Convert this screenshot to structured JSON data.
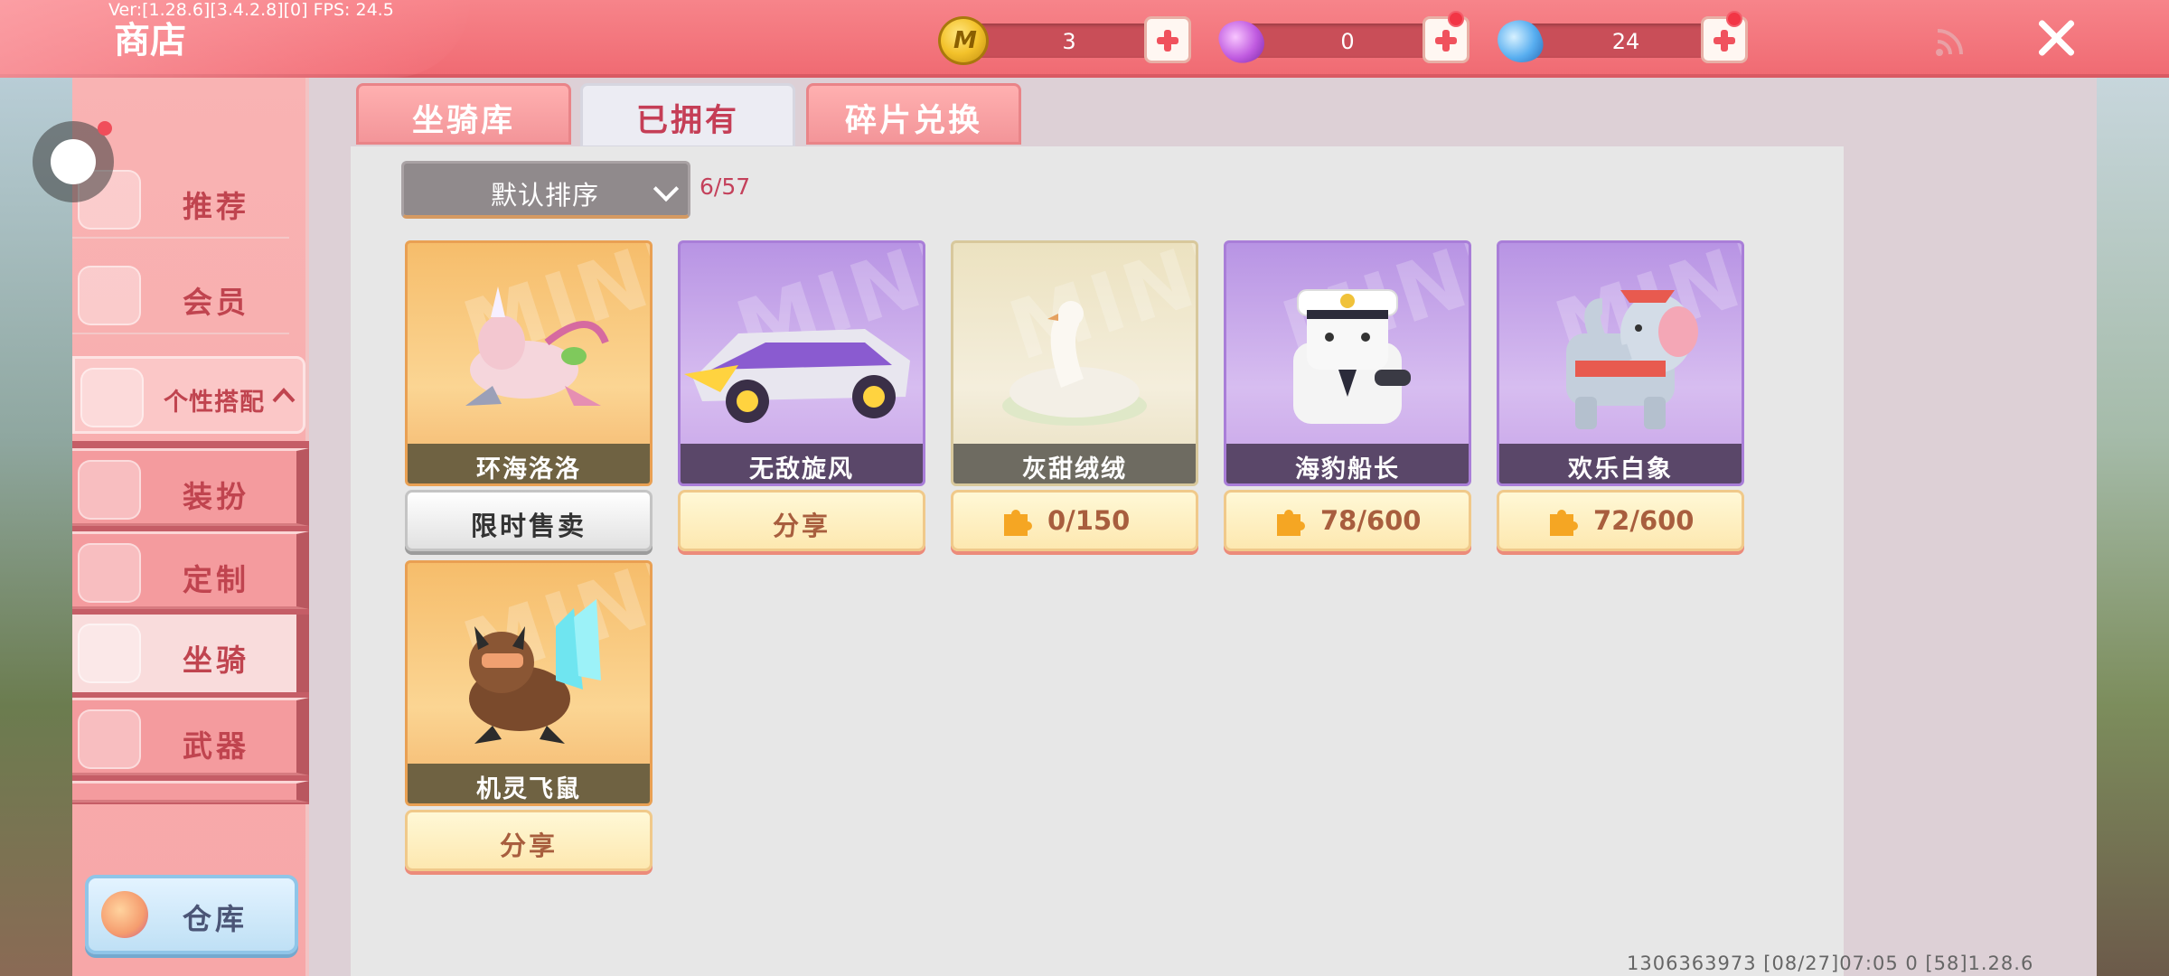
{
  "header": {
    "version_text": "Ver:[1.28.6][3.4.2.8][0] FPS: 24.5",
    "title": "商店",
    "currencies": [
      {
        "icon": "mini-coin-icon",
        "value": "3"
      },
      {
        "icon": "purple-gem-icon",
        "value": "0"
      },
      {
        "icon": "blue-gem-icon",
        "value": "24"
      }
    ]
  },
  "sidebar": {
    "items": [
      {
        "label": "推荐",
        "icon": "thumbs-up-icon"
      },
      {
        "label": "会员",
        "icon": "vip-icon"
      },
      {
        "label": "个性搭配",
        "icon": "personalize-icon",
        "expanded": true
      },
      {
        "label": "装扮",
        "icon": "shirt-icon"
      },
      {
        "label": "定制",
        "icon": "custom-icon"
      },
      {
        "label": "坐骑",
        "icon": "mount-icon",
        "active": true
      },
      {
        "label": "武器",
        "icon": "gun-icon"
      }
    ],
    "warehouse_label": "仓库"
  },
  "tabs": [
    {
      "label": "坐骑库"
    },
    {
      "label": "已拥有",
      "active": true
    },
    {
      "label": "碎片兑换"
    }
  ],
  "sort": {
    "label": "默认排序",
    "count": "6/57"
  },
  "cards": [
    {
      "name": "环海洛洛",
      "action": "限时售卖",
      "theme": "gold"
    },
    {
      "name": "无敌旋风",
      "action": "分享",
      "theme": "purple"
    },
    {
      "name": "灰甜绒绒",
      "fragments": "0/150",
      "theme": "beige"
    },
    {
      "name": "海豹船长",
      "fragments": "78/600",
      "theme": "purple"
    },
    {
      "name": "欢乐白象",
      "fragments": "72/600",
      "theme": "purple"
    },
    {
      "name": "机灵飞鼠",
      "action": "分享",
      "theme": "gold"
    }
  ],
  "card_watermark": "MINI",
  "footer": {
    "text": "1306363973   [08/27]07:05 0 [58]1.28.6"
  },
  "colors": {
    "accent": "#f06b73",
    "active_text": "#c53e56",
    "count_text": "#c4415b"
  }
}
